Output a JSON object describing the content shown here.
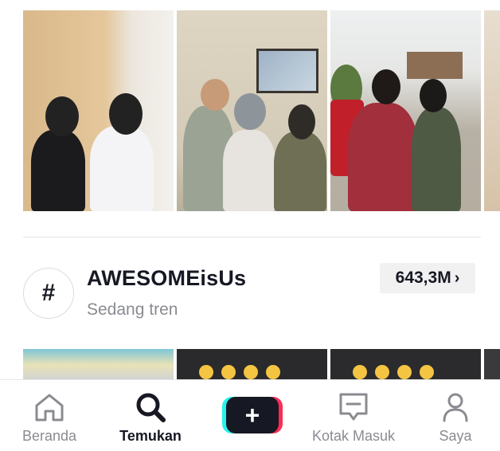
{
  "hashtag": {
    "symbol": "#",
    "name": "AWESOMEisUs",
    "subtitle": "Sedang tren",
    "view_count": "643,3M",
    "chevron": "›"
  },
  "nav": {
    "home_label": "Beranda",
    "discover_label": "Temukan",
    "create_symbol": "+",
    "inbox_label": "Kotak Masuk",
    "profile_label": "Saya",
    "active_tab": "discover"
  },
  "icons": {
    "home": "home-icon",
    "discover": "search-icon",
    "create": "plus-icon",
    "inbox": "inbox-message-icon",
    "profile": "person-icon"
  },
  "colors": {
    "text_primary": "#161823",
    "text_secondary": "#8a8b91",
    "brand_cyan": "#25f4ee",
    "brand_pink": "#fe2c55"
  }
}
